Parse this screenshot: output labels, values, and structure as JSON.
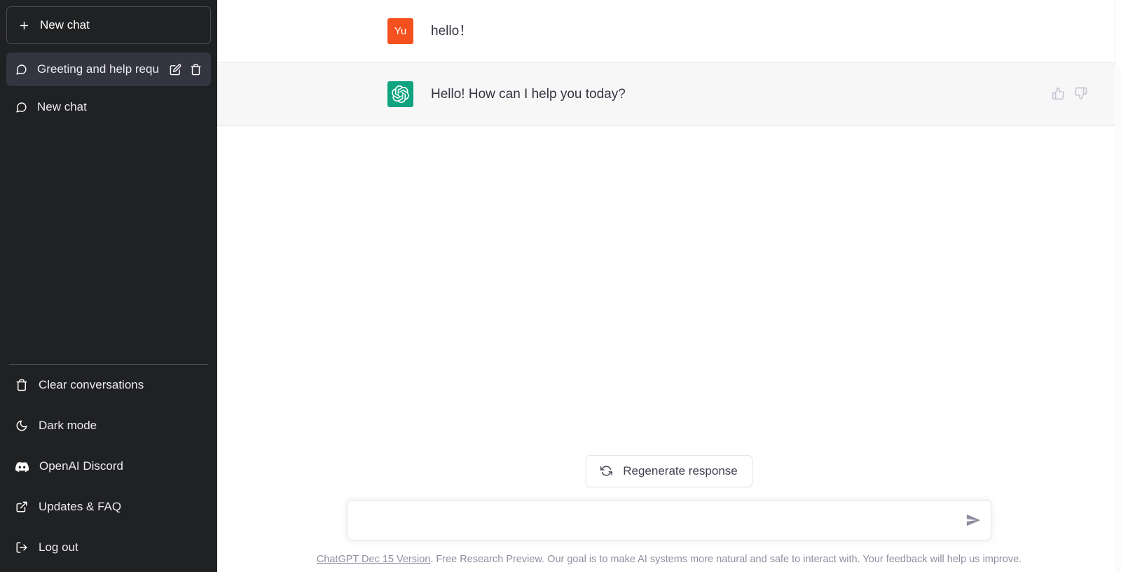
{
  "sidebar": {
    "new_chat": {
      "label": "New chat",
      "icon": "plus-icon"
    },
    "conversations": [
      {
        "label": "Greeting and help requ",
        "icon": "chat-bubble-icon",
        "active": true,
        "edit_icon": "pencil-icon",
        "delete_icon": "trash-icon"
      },
      {
        "label": "New chat",
        "icon": "chat-bubble-icon",
        "active": false
      }
    ],
    "footer_items": [
      {
        "label": "Clear conversations",
        "icon": "trash-icon"
      },
      {
        "label": "Dark mode",
        "icon": "moon-icon"
      },
      {
        "label": "OpenAI Discord",
        "icon": "discord-icon"
      },
      {
        "label": "Updates & FAQ",
        "icon": "external-link-icon"
      },
      {
        "label": "Log out",
        "icon": "logout-icon"
      }
    ]
  },
  "thread": {
    "messages": [
      {
        "role": "user",
        "avatar_text": "Yu",
        "avatar_color": "#f4511e",
        "text": "hello！"
      },
      {
        "role": "assistant",
        "avatar_text": "",
        "avatar_color": "#10a37f",
        "text": "Hello! How can I help you today?",
        "thumbs_up_icon": "thumbs-up-icon",
        "thumbs_down_icon": "thumbs-down-icon"
      }
    ]
  },
  "composer": {
    "regenerate_label": "Regenerate response",
    "regenerate_icon": "refresh-icon",
    "input_value": "",
    "input_placeholder": "",
    "send_icon": "send-icon"
  },
  "footer": {
    "version_link": "ChatGPT Dec 15 Version",
    "notice": ". Free Research Preview. Our goal is to make AI systems more natural and safe to interact with. Your feedback will help us improve."
  },
  "colors": {
    "sidebar_bg": "#202123",
    "active_conv_bg": "#343541",
    "assistant_row_bg": "#f7f7f8",
    "accent_green": "#10a37f",
    "accent_orange": "#f4511e"
  }
}
